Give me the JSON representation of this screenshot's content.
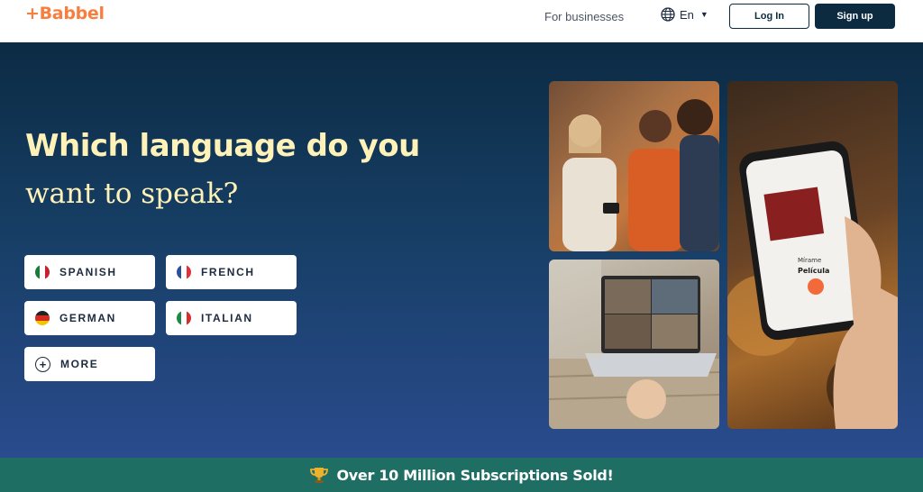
{
  "header": {
    "logo": "+Babbel",
    "for_businesses": "For businesses",
    "language_selector": {
      "icon": "globe-icon",
      "value": "En"
    },
    "login_label": "Log In",
    "signup_label": "Sign up"
  },
  "hero": {
    "title_line1": "Which language do you",
    "title_line2": "want to speak?",
    "languages": [
      {
        "label": "SPANISH",
        "icon": "mexico-flag-icon"
      },
      {
        "label": "FRENCH",
        "icon": "france-flag-icon"
      },
      {
        "label": "GERMAN",
        "icon": "germany-flag-icon"
      },
      {
        "label": "ITALIAN",
        "icon": "italy-flag-icon"
      },
      {
        "label": "MORE",
        "icon": "plus-circle-icon"
      }
    ],
    "phone_screen": {
      "word": "Película",
      "sublabel": "Mírame"
    }
  },
  "banner": {
    "icon": "trophy-icon",
    "text": "Over 10 Million Subscriptions Sold!"
  },
  "colors": {
    "brand_orange": "#f97e3e",
    "navy": "#0c2a40",
    "headline_cream": "#fff2b8",
    "banner_teal": "#1f6e64"
  }
}
